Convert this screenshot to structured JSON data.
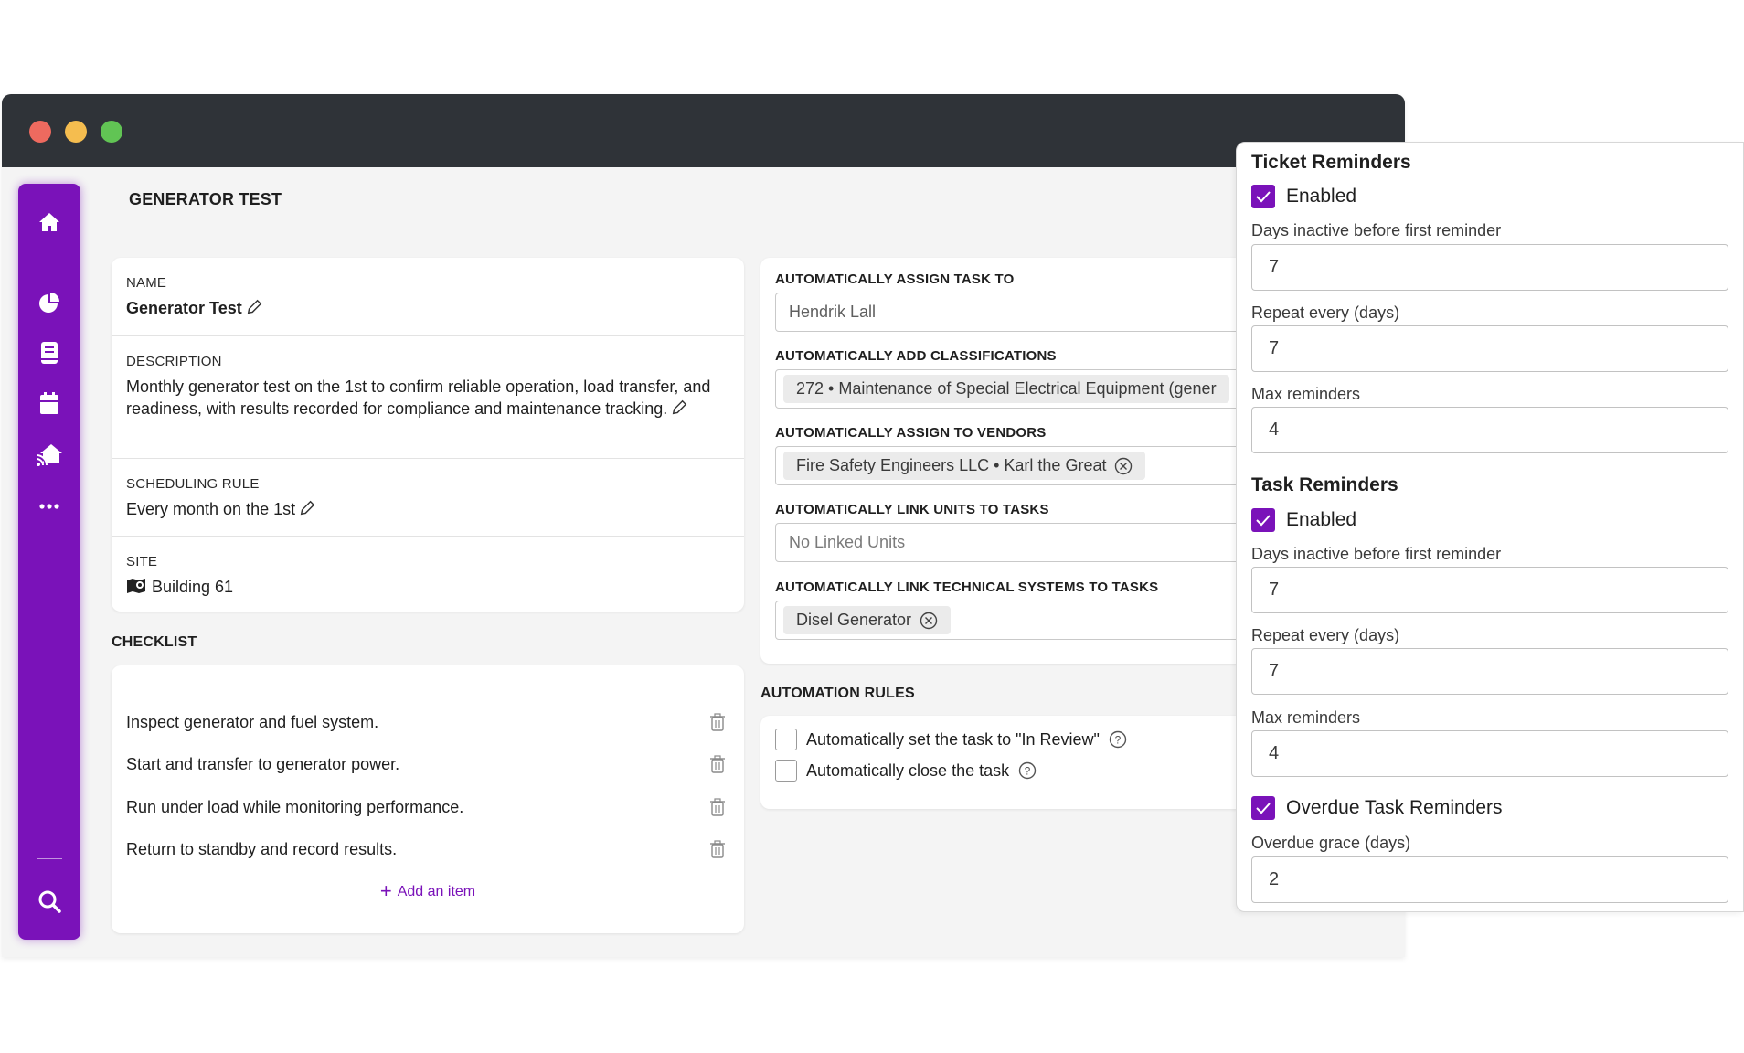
{
  "app": {
    "page_title": "GENERATOR TEST"
  },
  "sidebar": {
    "items": [
      {
        "icon": "home-icon"
      },
      {
        "icon": "pie-chart-icon"
      },
      {
        "icon": "book-icon"
      },
      {
        "icon": "calendar-icon"
      },
      {
        "icon": "house-signal-icon"
      },
      {
        "icon": "more-icon"
      }
    ],
    "search_icon": "search-icon"
  },
  "details": {
    "name_label": "NAME",
    "name_value": "Generator Test",
    "description_label": "DESCRIPTION",
    "description_value": "Monthly generator test on the 1st to confirm reliable operation, load transfer, and readiness, with results recorded for compliance and maintenance tracking.",
    "scheduling_label": "SCHEDULING RULE",
    "scheduling_value": "Every month on the 1st",
    "site_label": "SITE",
    "site_value": "Building 61"
  },
  "checklist": {
    "label": "CHECKLIST",
    "items": [
      "Inspect generator and fuel system.",
      "Start and transfer to generator power.",
      "Run under load while monitoring performance.",
      "Return to standby and record results."
    ],
    "add_label": "Add an item"
  },
  "automation": {
    "assign_task_label": "AUTOMATICALLY ASSIGN TASK TO",
    "assign_task_value": "Hendrik Lall",
    "classifications_label": "AUTOMATICALLY ADD CLASSIFICATIONS",
    "classification_chip": "272 • Maintenance of Special Electrical Equipment (gener",
    "vendors_label": "AUTOMATICALLY ASSIGN TO VENDORS",
    "vendor_chip": "Fire Safety Engineers LLC • Karl the Great",
    "units_label": "AUTOMATICALLY LINK UNITS TO TASKS",
    "units_placeholder": "No Linked Units",
    "systems_label": "AUTOMATICALLY LINK TECHNICAL SYSTEMS TO TASKS",
    "system_chip": "Disel Generator"
  },
  "rules": {
    "label": "AUTOMATION RULES",
    "items": [
      {
        "text": "Automatically set the task to \"In Review\"",
        "checked": false
      },
      {
        "text": "Automatically close the task",
        "checked": false
      }
    ]
  },
  "reminders": {
    "ticket": {
      "title": "Ticket Reminders",
      "enabled_label": "Enabled",
      "enabled": true,
      "days_label": "Days inactive before first reminder",
      "days_value": "7",
      "repeat_label": "Repeat every (days)",
      "repeat_value": "7",
      "max_label": "Max reminders",
      "max_value": "4"
    },
    "task": {
      "title": "Task Reminders",
      "enabled_label": "Enabled",
      "enabled": true,
      "days_label": "Days inactive before first reminder",
      "days_value": "7",
      "repeat_label": "Repeat every (days)",
      "repeat_value": "7",
      "max_label": "Max reminders",
      "max_value": "4"
    },
    "overdue": {
      "label": "Overdue Task Reminders",
      "enabled": true,
      "grace_label": "Overdue grace (days)",
      "grace_value": "2"
    }
  },
  "colors": {
    "accent": "#7a12b9",
    "titlebar": "#2f3338"
  }
}
